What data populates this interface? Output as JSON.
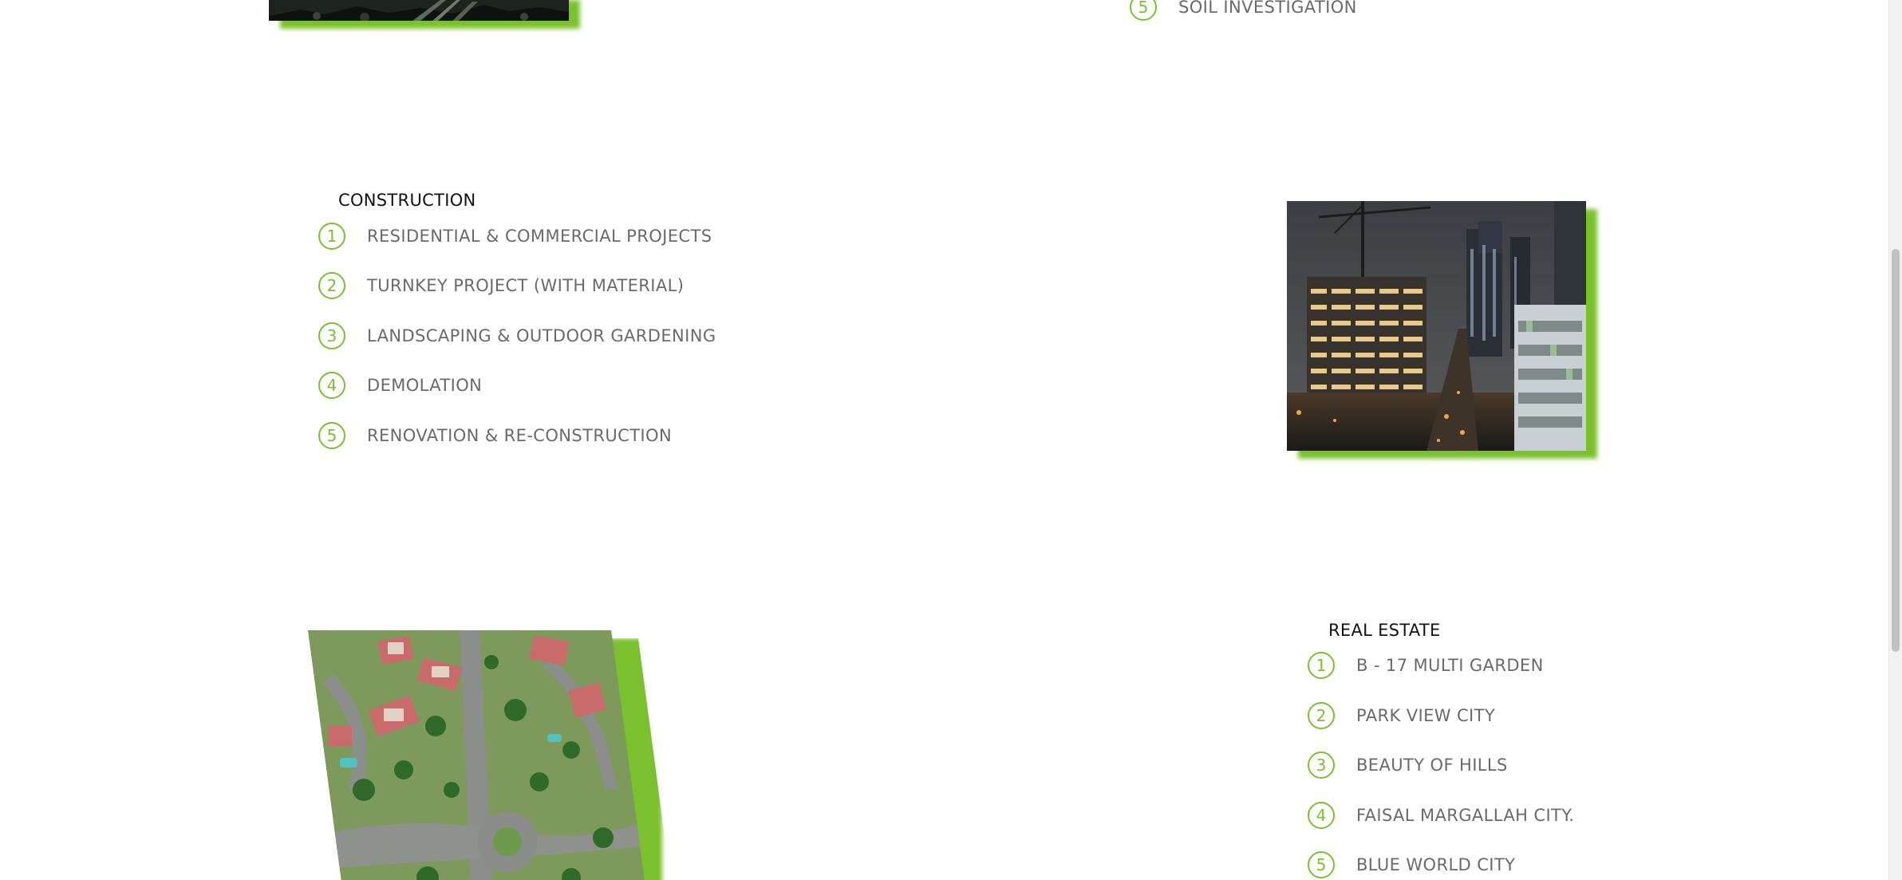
{
  "top_section": {
    "item": {
      "number": "5",
      "label": "SOIL INVESTIGATION"
    }
  },
  "construction": {
    "title": "CONSTRUCTION",
    "items": [
      {
        "number": "1",
        "label": "RESIDENTIAL & COMMERCIAL PROJECTS"
      },
      {
        "number": "2",
        "label": "TURNKEY PROJECT (WITH MATERIAL)"
      },
      {
        "number": "3",
        "label": "LANDSCAPING & OUTDOOR GARDENING"
      },
      {
        "number": "4",
        "label": "DEMOLATION"
      },
      {
        "number": "5",
        "label": "RENOVATION & RE-CONSTRUCTION"
      }
    ]
  },
  "real_estate": {
    "title": "REAL ESTATE",
    "items": [
      {
        "number": "1",
        "label": "B - 17 MULTI GARDEN"
      },
      {
        "number": "2",
        "label": "PARK VIEW CITY"
      },
      {
        "number": "3",
        "label": "BEAUTY OF HILLS"
      },
      {
        "number": "4",
        "label": "FAISAL MARGALLAH CITY."
      },
      {
        "number": "5",
        "label": "BLUE WORLD CITY"
      }
    ]
  },
  "colors": {
    "accent": "#7bc12e",
    "title_text": "#111111",
    "item_text": "#6a6a6a",
    "background": "#ffffff"
  }
}
